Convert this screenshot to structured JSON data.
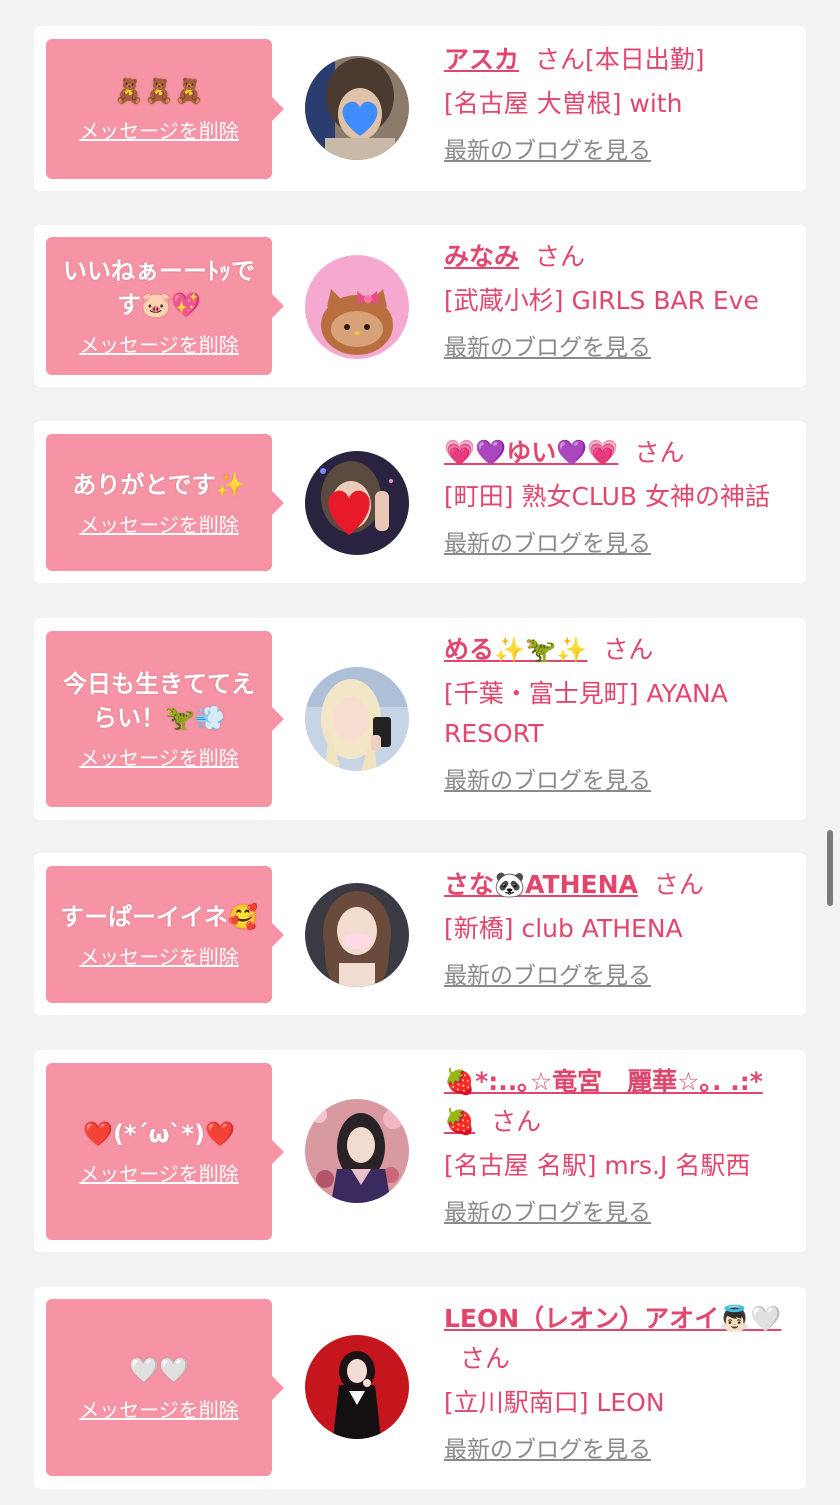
{
  "messages": [
    {
      "bubble_text": "🧸🧸🧸",
      "delete_label": "メッセージを削除",
      "name": "アスカ",
      "san": "さん",
      "status": "[本日出勤]",
      "shop": "[名古屋 大曽根] with",
      "blog_link": "最新のブログを見る",
      "avatar": "blurred-photo-heart-sticker"
    },
    {
      "bubble_text": "いいねぁーーﾄｯです🐷💖",
      "delete_label": "メッセージを削除",
      "name": "みなみ",
      "san": "さん",
      "status": "",
      "shop": "[武蔵小杉] GIRLS BAR Eve",
      "blog_link": "最新のブログを見る",
      "avatar": "hello-kitty-illustration"
    },
    {
      "bubble_text": "ありがとです✨",
      "delete_label": "メッセージを削除",
      "name": "💗💜ゆい💜💗",
      "san": "さん",
      "status": "",
      "shop": "[町田] 熟女CLUB 女神の神話",
      "blog_link": "最新のブログを見る",
      "avatar": "photo-heart-sticker"
    },
    {
      "bubble_text": "今日も生きててえらい！🦖💨",
      "delete_label": "メッセージを削除",
      "name": "める✨🦖✨",
      "san": "さん",
      "status": "",
      "shop": "[千葉・富士見町] AYANA RESORT",
      "blog_link": "最新のブログを見る",
      "avatar": "blonde-selfie"
    },
    {
      "bubble_text": "すーぱーイイネ🥰",
      "delete_label": "メッセージを削除",
      "name": "さな🐼ATHENA",
      "san": "さん",
      "status": "",
      "shop": "[新橋] club ATHENA",
      "blog_link": "最新のブログを見る",
      "avatar": "brunette-portrait-mask"
    },
    {
      "bubble_text": "❤️(*´ω`*)❤️",
      "delete_label": "メッセージを削除",
      "name": "🍓*:..｡☆竜宮　麗華☆｡. .:*🍓",
      "san": "さん",
      "status": "",
      "shop": "[名古屋 名駅] mrs.J 名駅西",
      "blog_link": "最新のブログを見る",
      "avatar": "kimono-floral-portrait"
    },
    {
      "bubble_text": "🤍🤍",
      "delete_label": "メッセージを削除",
      "name": "LEON（レオン）アオイ👼🏻🤍",
      "san": "さん",
      "status": "",
      "shop": "[立川駅南口] LEON",
      "blog_link": "最新のブログを見る",
      "avatar": "red-background-portrait"
    }
  ],
  "colors": {
    "page_bg": "#f2f2f2",
    "bubble_bg": "#f693a4",
    "accent": "#e2466d",
    "link_gray": "#8a8a8a"
  }
}
